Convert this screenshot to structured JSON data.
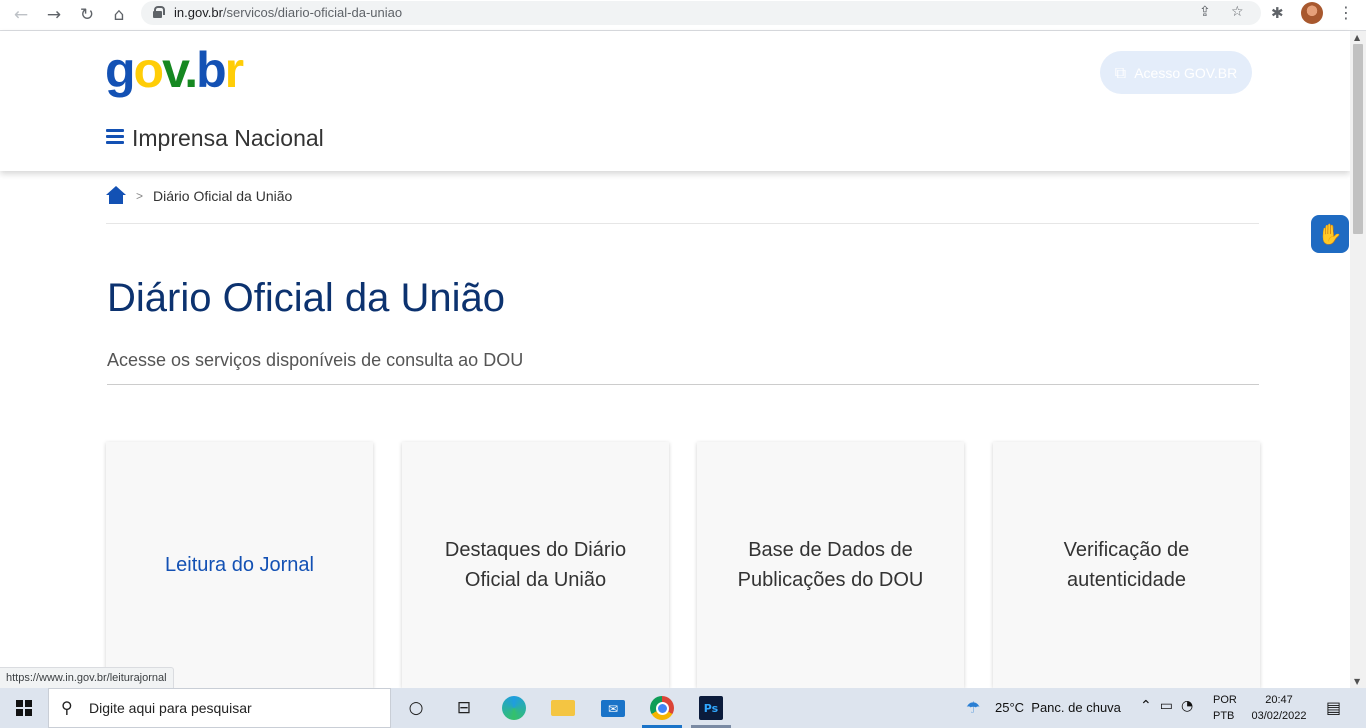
{
  "browser": {
    "url_host": "in.gov.br",
    "url_path": "/servicos/diario-oficial-da-uniao",
    "status_url": "https://www.in.gov.br/leiturajornal"
  },
  "header": {
    "logo_text": "gov.br",
    "login_label": "Acesso GOV.BR",
    "site_title": "Imprensa Nacional"
  },
  "breadcrumb": {
    "separator": ">",
    "current": "Diário Oficial da União"
  },
  "main": {
    "title": "Diário Oficial da União",
    "subtitle": "Acesse os serviços disponíveis de consulta ao DOU",
    "cards": [
      {
        "label": "Leitura do Jornal"
      },
      {
        "label": "Destaques do Diário Oficial da União"
      },
      {
        "label": "Base de Dados de Publicações do DOU"
      },
      {
        "label": "Verificação de autenticidade"
      }
    ]
  },
  "taskbar": {
    "search_placeholder": "Digite aqui para pesquisar",
    "weather_temp": "25°C",
    "weather_desc": "Panc. de chuva",
    "lang_top": "POR",
    "lang_bottom": "PTB",
    "time": "20:47",
    "date": "03/02/2022",
    "ps_label": "Ps"
  },
  "colors": {
    "brand_blue": "#1351b4",
    "title_navy": "#0c326f",
    "gov_yellow": "#ffcd07",
    "gov_green": "#168821"
  }
}
